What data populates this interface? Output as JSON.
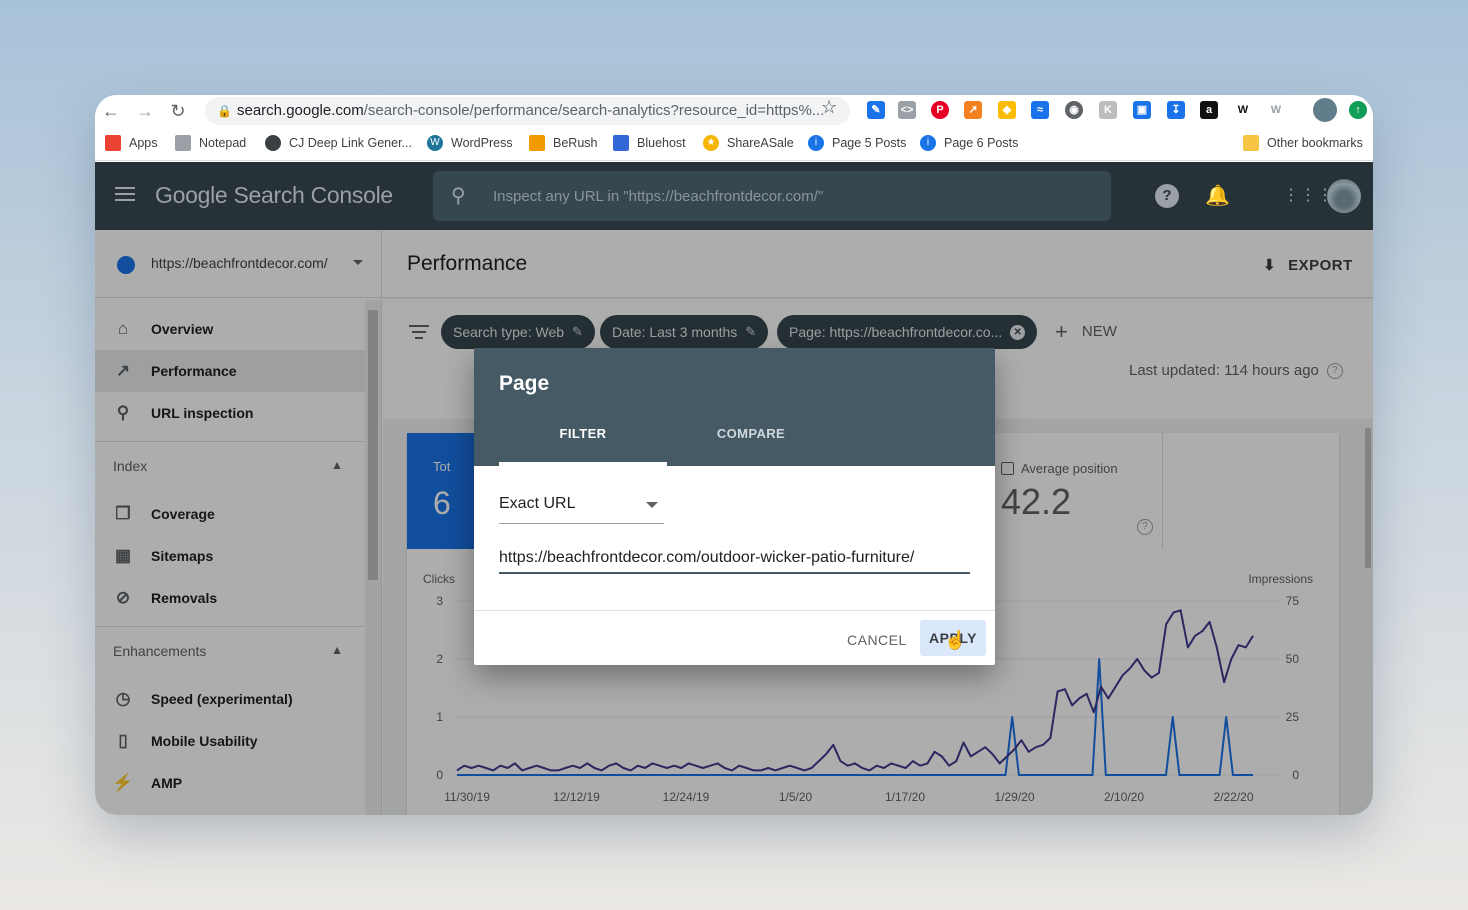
{
  "browser": {
    "url_host": "search.google.com",
    "url_path": "/search-console/performance/search-analytics?resource_id=https%...",
    "bookmarks": [
      {
        "label": "Apps",
        "color": "#ea4335"
      },
      {
        "label": "Notepad",
        "color": "#9aa0a6"
      },
      {
        "label": "CJ Deep Link Gener...",
        "color": "#3c4043"
      },
      {
        "label": "WordPress",
        "color": "#21759b"
      },
      {
        "label": "BeRush",
        "color": "#f29900"
      },
      {
        "label": "Bluehost",
        "color": "#3367d6"
      },
      {
        "label": "ShareASale",
        "color": "#f6b400"
      },
      {
        "label": "Page 5 Posts",
        "color": "#1a73e8"
      },
      {
        "label": "Page 6 Posts",
        "color": "#1a73e8"
      }
    ],
    "other_bookmarks": "Other bookmarks"
  },
  "header": {
    "logo": "Google Search Console",
    "search_placeholder": "Inspect any URL in \"https://beachfrontdecor.com/\""
  },
  "sidebar": {
    "property": "https://beachfrontdecor.com/",
    "items": [
      {
        "label": "Overview",
        "icon": "home-icon"
      },
      {
        "label": "Performance",
        "icon": "trending-icon"
      },
      {
        "label": "URL inspection",
        "icon": "search-icon"
      }
    ],
    "index_label": "Index",
    "index_items": [
      {
        "label": "Coverage",
        "icon": "copy-icon"
      },
      {
        "label": "Sitemaps",
        "icon": "sitemap-icon"
      },
      {
        "label": "Removals",
        "icon": "hide-icon"
      }
    ],
    "enhancements_label": "Enhancements",
    "enhancement_items": [
      {
        "label": "Speed (experimental)",
        "icon": "speedometer-icon"
      },
      {
        "label": "Mobile Usability",
        "icon": "phone-icon"
      },
      {
        "label": "AMP",
        "icon": "bolt-icon"
      }
    ]
  },
  "main": {
    "title": "Performance",
    "export": "EXPORT",
    "chips": [
      "Search type: Web",
      "Date: Last 3 months",
      "Page: https://beachfrontdecor.co..."
    ],
    "new_label": "NEW",
    "last_updated": "Last updated: 114 hours ago",
    "clicks_tile_label": "Tot",
    "clicks_tile_value": "6",
    "position_label": "Average position",
    "position_value": "42.2"
  },
  "chart_data": {
    "type": "line",
    "x": [
      "11/30/19",
      "12/12/19",
      "12/24/19",
      "1/5/20",
      "1/17/20",
      "1/29/20",
      "2/10/20",
      "2/22/20"
    ],
    "y_left_label": "Clicks",
    "y_left_ticks": [
      0,
      1,
      2,
      3
    ],
    "y_right_label": "Impressions",
    "y_right_ticks": [
      0,
      25,
      50,
      75
    ],
    "series": [
      {
        "name": "Clicks",
        "color": "#1a73e8",
        "values": [
          0,
          0,
          0,
          0,
          0,
          0,
          0,
          0,
          0,
          0,
          0,
          0,
          0,
          0,
          0,
          0,
          0,
          0,
          0,
          0,
          0,
          0,
          0,
          0,
          0,
          0,
          0,
          0,
          0,
          0,
          0,
          0,
          0,
          0,
          0,
          0,
          0,
          0,
          0,
          0,
          0,
          0,
          0,
          0,
          0,
          0,
          0,
          0,
          0,
          0,
          0,
          0,
          0,
          0,
          0,
          0,
          0,
          0,
          0,
          0,
          0,
          0,
          0,
          0,
          0,
          0,
          0,
          0,
          0,
          0,
          0,
          0,
          0,
          0,
          0,
          0,
          0,
          0,
          0,
          0,
          0,
          0,
          0,
          1,
          0,
          0,
          0,
          0,
          0,
          0,
          0,
          0,
          0,
          0,
          0,
          0,
          2,
          0,
          0,
          0,
          0,
          0,
          0,
          0,
          0,
          0,
          0,
          1,
          0,
          0,
          0,
          0,
          0,
          0,
          0,
          1,
          0,
          0,
          0,
          0
        ]
      },
      {
        "name": "Impressions",
        "color": "#3f3a8f",
        "values": [
          2,
          4,
          3,
          4,
          3,
          2,
          4,
          3,
          5,
          2,
          3,
          4,
          3,
          2,
          2,
          3,
          4,
          3,
          5,
          3,
          2,
          4,
          5,
          3,
          2,
          4,
          3,
          5,
          4,
          3,
          4,
          3,
          5,
          4,
          3,
          4,
          5,
          3,
          2,
          4,
          3,
          2,
          2,
          3,
          2,
          3,
          4,
          3,
          2,
          3,
          6,
          9,
          13,
          6,
          4,
          5,
          3,
          2,
          4,
          3,
          5,
          4,
          3,
          6,
          4,
          5,
          10,
          8,
          4,
          6,
          14,
          8,
          10,
          12,
          9,
          5,
          8,
          11,
          15,
          10,
          12,
          13,
          16,
          36,
          37,
          30,
          33,
          35,
          27,
          38,
          33,
          38,
          43,
          46,
          50,
          45,
          42,
          44,
          65,
          70,
          71,
          55,
          60,
          62,
          66,
          55,
          40,
          50,
          56,
          55,
          60
        ]
      }
    ]
  },
  "dialog": {
    "title": "Page",
    "tab_filter": "FILTER",
    "tab_compare": "COMPARE",
    "match_type": "Exact URL",
    "url_value": "https://beachfrontdecor.com/outdoor-wicker-patio-furniture/",
    "cancel": "CANCEL",
    "apply": "APPLY"
  }
}
